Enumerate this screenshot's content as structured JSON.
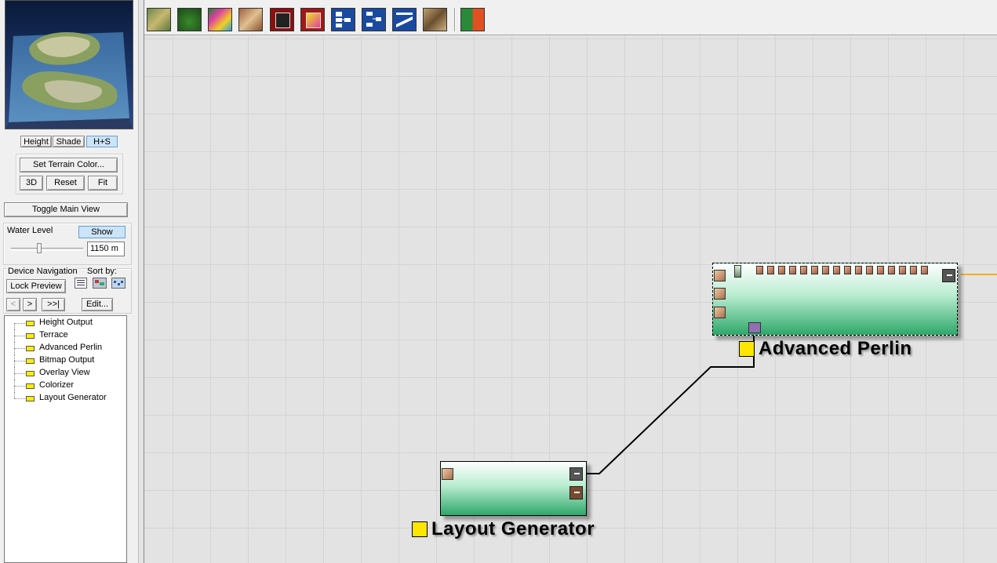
{
  "preview": {
    "view_buttons": [
      "Height",
      "Shade",
      "H+S"
    ],
    "active_view": "H+S",
    "set_terrain_color": "Set Terrain Color...",
    "btn_3d": "3D",
    "btn_reset": "Reset",
    "btn_fit": "Fit"
  },
  "toggle_main_view": "Toggle Main View",
  "water": {
    "label": "Water Level",
    "show_button": "Show",
    "value": "1150 m",
    "level_fraction": 0.39
  },
  "device_nav": {
    "label": "Device Navigation",
    "sort_label": "Sort by:",
    "lock_preview": "Lock Preview",
    "nav_prev": "<",
    "nav_next": ">",
    "nav_last": ">>|",
    "edit": "Edit...",
    "devices": [
      "Height Output",
      "Terrace",
      "Advanced Perlin",
      "Bitmap Output",
      "Overlay View",
      "Colorizer",
      "Layout Generator"
    ]
  },
  "toolbar": {
    "icons": [
      "terrain-map-icon",
      "terrain-green-icon",
      "rainbow-terrain-icon",
      "texture-icon",
      "save-red-icon",
      "save-color-icon",
      "tree-layout-icon",
      "branch-layout-icon",
      "slope-icon",
      "rock-texture-icon",
      "color-gradient-icon"
    ]
  },
  "nodes": {
    "advanced_perlin": "Advanced Perlin",
    "layout_generator": "Layout Generator"
  },
  "colors": {
    "port_yellow": "#ffe600",
    "connection": "#000000",
    "output_wire": "#f0b020"
  }
}
